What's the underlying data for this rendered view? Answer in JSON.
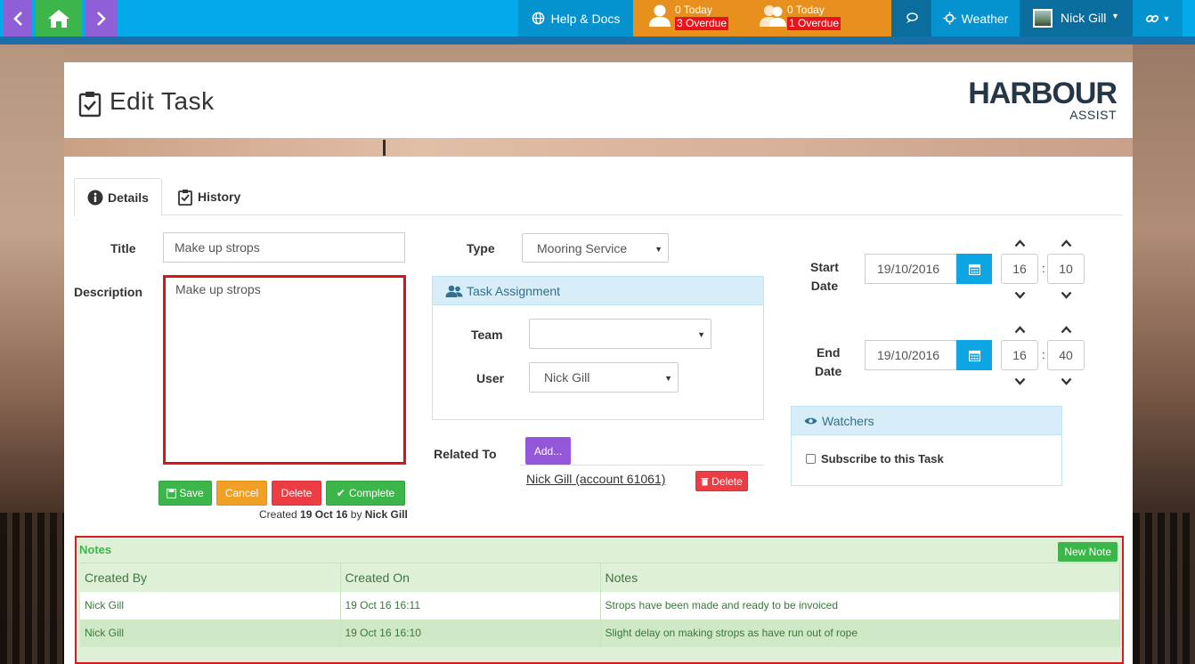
{
  "topbar": {
    "help_label": "Help & Docs",
    "my_tasks": {
      "today": "0 Today",
      "overdue": "3 Overdue"
    },
    "team_tasks": {
      "today": "0 Today",
      "overdue": "1 Overdue"
    },
    "weather_label": "Weather",
    "user_name": "Nick Gill"
  },
  "header": {
    "title": "Edit Task",
    "logo_main": "HARBOUR",
    "logo_sub": "ASSIST"
  },
  "tabs": [
    {
      "label": "Details",
      "active": true
    },
    {
      "label": "History",
      "active": false
    }
  ],
  "form": {
    "title_label": "Title",
    "title_value": "Make up strops",
    "description_label": "Description",
    "description_value": "Make up strops",
    "type_label": "Type",
    "type_value": "Mooring Service",
    "assignment": {
      "heading": "Task Assignment",
      "team_label": "Team",
      "team_value": "",
      "user_label": "User",
      "user_value": "Nick Gill"
    },
    "related": {
      "label": "Related To",
      "add_label": "Add...",
      "link_text": "Nick Gill (account 61061)",
      "delete_label": "Delete"
    },
    "start": {
      "label_line1": "Start",
      "label_line2": "Date",
      "date": "19/10/2016",
      "hour": "16",
      "minute": "10"
    },
    "end": {
      "label_line1": "End",
      "label_line2": "Date",
      "date": "19/10/2016",
      "hour": "16",
      "minute": "40"
    },
    "time_separator": ":",
    "watchers": {
      "heading": "Watchers",
      "subscribe_label": "Subscribe to this Task",
      "subscribed": false
    },
    "actions": {
      "save": "Save",
      "cancel": "Cancel",
      "delete": "Delete",
      "complete": "Complete"
    },
    "created": {
      "prefix": "Created",
      "date": "19 Oct 16",
      "by": "by",
      "user": "Nick Gill"
    }
  },
  "notes": {
    "title": "Notes",
    "new_note_label": "New Note",
    "columns": [
      "Created By",
      "Created On",
      "Notes"
    ],
    "rows": [
      [
        "Nick Gill",
        "19 Oct 16 16:11",
        "Strops have been made and ready to be invoiced"
      ],
      [
        "Nick Gill",
        "19 Oct 16 16:10",
        "Slight delay on making strops as have run out of rope"
      ]
    ]
  },
  "colors": {
    "topbar": "#03a9e8",
    "accent_green": "#3cb54a",
    "accent_purple": "#8e5fd6",
    "task_orange": "#e8901e",
    "overdue_red": "#e8141b",
    "highlight_red": "#d71920"
  }
}
